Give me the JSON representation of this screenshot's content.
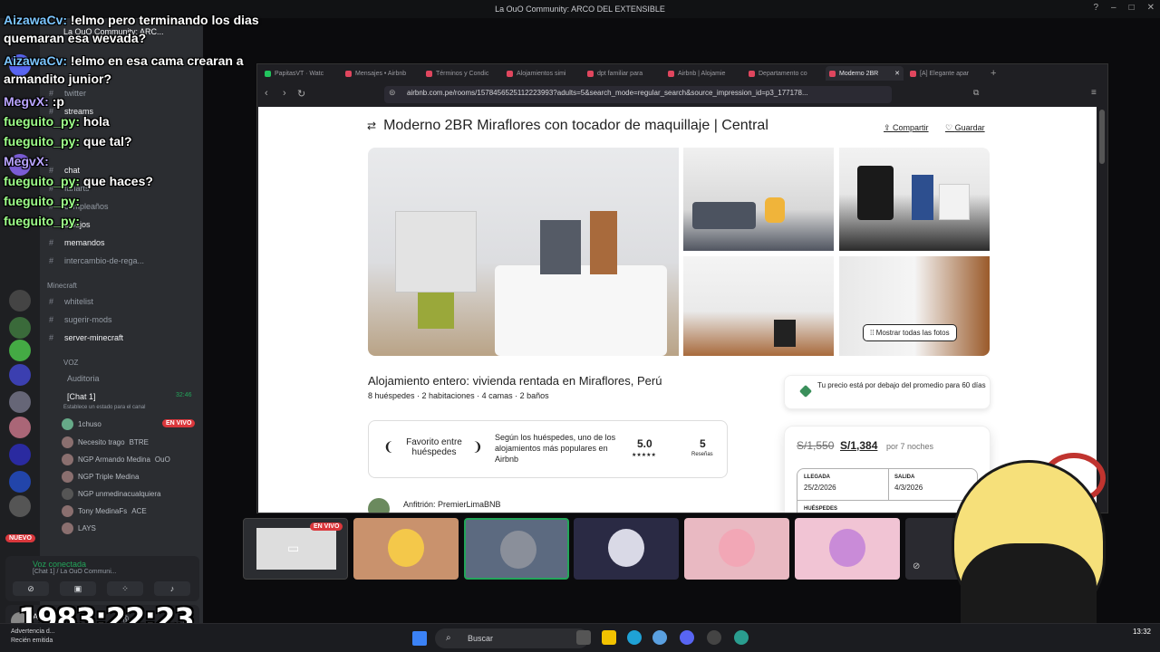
{
  "window": {
    "title": "La OuO Community: ARCO DEL EXTENSIBLE"
  },
  "chat_overlay": [
    {
      "user": "AizawaCv:",
      "text": "!elmo pero terminando los dias quemaran esa wevada?"
    },
    {
      "user": "AizawaCv:",
      "text": "!elmo en esa cama crearan a armandito junior?"
    },
    {
      "user": "MegvX:",
      "text": ":p"
    },
    {
      "user": "fueguito_py:",
      "text": "hola"
    },
    {
      "user": "fueguito_py:",
      "text": "que tal?"
    },
    {
      "user": "MegvX:",
      "text": ""
    },
    {
      "user": "fueguito_py:",
      "text": "que haces?"
    },
    {
      "user": "fueguito_py:",
      "text": ""
    },
    {
      "user": "fueguito_py:",
      "text": ""
    }
  ],
  "discord": {
    "server_name": "La OuO Community: ARC...",
    "channels": [
      "twitter",
      "streams",
      "chat",
      "fanarts",
      "cumpleaños",
      "dibujos",
      "memandos",
      "intercambio-de-rega..."
    ],
    "category_minecraft": "Minecraft",
    "minecraft_channels": [
      "whitelist",
      "sugerir-mods",
      "server-minecraft"
    ],
    "category_voz": "VOZ",
    "voice_channels": [
      "Auditoria",
      "[Chat 1]"
    ],
    "voice_status": "Establece un estado para el canal",
    "voice_timer": "32:46",
    "voice_users": [
      {
        "name": "1chuso",
        "badge": "EN VIVO"
      },
      {
        "name": "Necesito trago",
        "badge": "BTRE"
      },
      {
        "name": "NGP Armando Medina",
        "badge": "OuO"
      },
      {
        "name": "NGP Triple Medina",
        "badge": ""
      },
      {
        "name": "NGP unmedinacualquiera",
        "badge": ""
      },
      {
        "name": "Tony MedinaFs",
        "badge": "ACE"
      },
      {
        "name": "",
        "badge": "LAYS"
      }
    ],
    "new_badge": "NUEVO",
    "voice_panel_title": "Voz conectada",
    "voice_panel_sub": "[Chat 1] / La OuO Communi...",
    "user_panel_name": "A..."
  },
  "timer": "1983:22:23",
  "browser": {
    "tabs": [
      {
        "label": "PapitasVT · Watc"
      },
      {
        "label": "Mensajes • Airbnb"
      },
      {
        "label": "Términos y Condic"
      },
      {
        "label": "Alojamientos simi"
      },
      {
        "label": "dpt familiar para"
      },
      {
        "label": "Airbnb | Alojamie"
      },
      {
        "label": "Departamento co"
      },
      {
        "label": "Moderno 2BR"
      },
      {
        "label": "[A] Elegante apar"
      }
    ],
    "url": "airbnb.com.pe/rooms/1578456525112223993?adults=5&search_mode=regular_search&source_impression_id=p3_177178..."
  },
  "listing": {
    "title": "Moderno 2BR Miraflores con tocador de maquillaje | Central",
    "share": "Compartir",
    "save": "Guardar",
    "show_all": "Mostrar todas las fotos",
    "subtitle": "Alojamiento entero: vivienda rentada en Miraflores, Perú",
    "details": "8 huéspedes · 2 habitaciones · 4 camas · 2 baños",
    "favorite_label": "Favorito entre huéspedes",
    "favorite_desc": "Según los huéspedes, uno de los alojamientos más populares en Airbnb",
    "rating": "5.0",
    "stars": "★★★★★",
    "reviews": "5",
    "reviews_label": "Reseñas",
    "host": "Anfitrión: PremierLimaBNB",
    "price_tip": "Tu precio está por debajo del promedio para 60 días",
    "price_old": "S/1,550",
    "price_new": "S/1,384",
    "price_per": "por 7 noches",
    "checkin_label": "LLEGADA",
    "checkin": "25/2/2026",
    "checkout_label": "SALIDA",
    "checkout": "4/3/2026",
    "guests_label": "HUÉSPEDES"
  },
  "stream_strip": {
    "live": "EN VIVO"
  },
  "taskbar": {
    "search": "Buscar",
    "notification_title": "Advertencia d...",
    "notification_sub": "Recién emitida",
    "time": "13:32"
  }
}
